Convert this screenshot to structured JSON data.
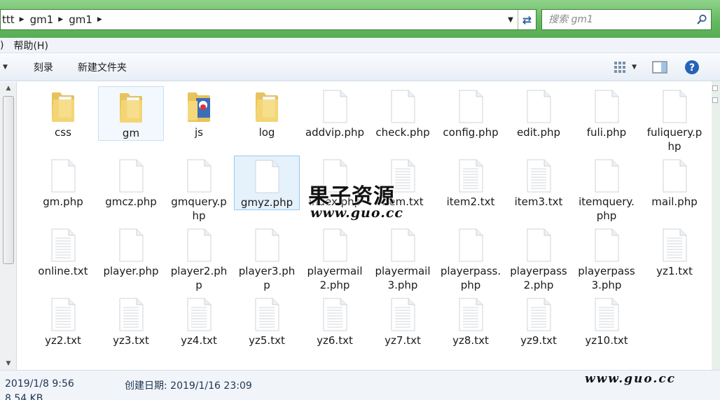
{
  "breadcrumb": {
    "items": [
      "ttt",
      "gm1",
      "gm1"
    ]
  },
  "search": {
    "placeholder": "搜索 gm1"
  },
  "menu": {
    "items": [
      ")",
      "帮助(H)"
    ]
  },
  "toolbar": {
    "burn_label": "刻录",
    "new_folder_label": "新建文件夹"
  },
  "files": [
    {
      "name": "css",
      "type": "folder"
    },
    {
      "name": "gm",
      "type": "folder"
    },
    {
      "name": "js",
      "type": "folder-img"
    },
    {
      "name": "log",
      "type": "folder"
    },
    {
      "name": "addvip.php",
      "type": "file"
    },
    {
      "name": "check.php",
      "type": "file"
    },
    {
      "name": "config.php",
      "type": "file"
    },
    {
      "name": "edit.php",
      "type": "file"
    },
    {
      "name": "fuli.php",
      "type": "file"
    },
    {
      "name": "fuliquery.php",
      "type": "file"
    },
    {
      "name": "gm.php",
      "type": "file"
    },
    {
      "name": "gmcz.php",
      "type": "file"
    },
    {
      "name": "gmquery.php",
      "type": "file"
    },
    {
      "name": "gmyz.php",
      "type": "file"
    },
    {
      "name": "index.php",
      "type": "file"
    },
    {
      "name": "item.txt",
      "type": "text"
    },
    {
      "name": "item2.txt",
      "type": "text"
    },
    {
      "name": "item3.txt",
      "type": "text"
    },
    {
      "name": "itemquery.php",
      "type": "file"
    },
    {
      "name": "mail.php",
      "type": "file"
    },
    {
      "name": "online.txt",
      "type": "text"
    },
    {
      "name": "player.php",
      "type": "file"
    },
    {
      "name": "player2.php",
      "type": "file"
    },
    {
      "name": "player3.php",
      "type": "file"
    },
    {
      "name": "playermail2.php",
      "type": "file"
    },
    {
      "name": "playermail3.php",
      "type": "file"
    },
    {
      "name": "playerpass.php",
      "type": "file"
    },
    {
      "name": "playerpass2.php",
      "type": "file"
    },
    {
      "name": "playerpass3.php",
      "type": "file"
    },
    {
      "name": "yz1.txt",
      "type": "text"
    },
    {
      "name": "yz2.txt",
      "type": "text"
    },
    {
      "name": "yz3.txt",
      "type": "text"
    },
    {
      "name": "yz4.txt",
      "type": "text"
    },
    {
      "name": "yz5.txt",
      "type": "text"
    },
    {
      "name": "yz6.txt",
      "type": "text"
    },
    {
      "name": "yz7.txt",
      "type": "text"
    },
    {
      "name": "yz8.txt",
      "type": "text"
    },
    {
      "name": "yz9.txt",
      "type": "text"
    },
    {
      "name": "yz10.txt",
      "type": "text"
    }
  ],
  "watermark": {
    "title": "果子资源",
    "url": "www.guo.cc"
  },
  "status": {
    "modified": "2019/1/8 9:56",
    "created_label": "创建日期:",
    "created_value": "2019/1/16 23:09",
    "size": "8.54 KB",
    "watermark": "www.guo.cc"
  }
}
